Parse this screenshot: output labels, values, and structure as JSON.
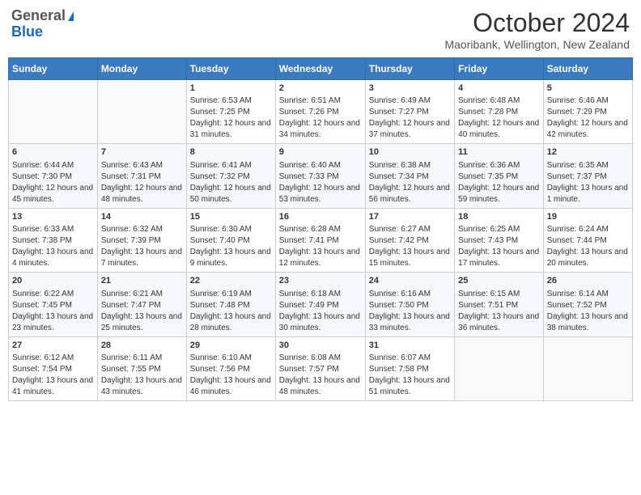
{
  "logo": {
    "general": "General",
    "blue": "Blue"
  },
  "title": "October 2024",
  "subtitle": "Maoribank, Wellington, New Zealand",
  "days_of_week": [
    "Sunday",
    "Monday",
    "Tuesday",
    "Wednesday",
    "Thursday",
    "Friday",
    "Saturday"
  ],
  "weeks": [
    [
      {
        "day": "",
        "sunrise": "",
        "sunset": "",
        "daylight": ""
      },
      {
        "day": "",
        "sunrise": "",
        "sunset": "",
        "daylight": ""
      },
      {
        "day": "1",
        "sunrise": "Sunrise: 6:53 AM",
        "sunset": "Sunset: 7:25 PM",
        "daylight": "Daylight: 12 hours and 31 minutes."
      },
      {
        "day": "2",
        "sunrise": "Sunrise: 6:51 AM",
        "sunset": "Sunset: 7:26 PM",
        "daylight": "Daylight: 12 hours and 34 minutes."
      },
      {
        "day": "3",
        "sunrise": "Sunrise: 6:49 AM",
        "sunset": "Sunset: 7:27 PM",
        "daylight": "Daylight: 12 hours and 37 minutes."
      },
      {
        "day": "4",
        "sunrise": "Sunrise: 6:48 AM",
        "sunset": "Sunset: 7:28 PM",
        "daylight": "Daylight: 12 hours and 40 minutes."
      },
      {
        "day": "5",
        "sunrise": "Sunrise: 6:46 AM",
        "sunset": "Sunset: 7:29 PM",
        "daylight": "Daylight: 12 hours and 42 minutes."
      }
    ],
    [
      {
        "day": "6",
        "sunrise": "Sunrise: 6:44 AM",
        "sunset": "Sunset: 7:30 PM",
        "daylight": "Daylight: 12 hours and 45 minutes."
      },
      {
        "day": "7",
        "sunrise": "Sunrise: 6:43 AM",
        "sunset": "Sunset: 7:31 PM",
        "daylight": "Daylight: 12 hours and 48 minutes."
      },
      {
        "day": "8",
        "sunrise": "Sunrise: 6:41 AM",
        "sunset": "Sunset: 7:32 PM",
        "daylight": "Daylight: 12 hours and 50 minutes."
      },
      {
        "day": "9",
        "sunrise": "Sunrise: 6:40 AM",
        "sunset": "Sunset: 7:33 PM",
        "daylight": "Daylight: 12 hours and 53 minutes."
      },
      {
        "day": "10",
        "sunrise": "Sunrise: 6:38 AM",
        "sunset": "Sunset: 7:34 PM",
        "daylight": "Daylight: 12 hours and 56 minutes."
      },
      {
        "day": "11",
        "sunrise": "Sunrise: 6:36 AM",
        "sunset": "Sunset: 7:35 PM",
        "daylight": "Daylight: 12 hours and 59 minutes."
      },
      {
        "day": "12",
        "sunrise": "Sunrise: 6:35 AM",
        "sunset": "Sunset: 7:37 PM",
        "daylight": "Daylight: 13 hours and 1 minute."
      }
    ],
    [
      {
        "day": "13",
        "sunrise": "Sunrise: 6:33 AM",
        "sunset": "Sunset: 7:38 PM",
        "daylight": "Daylight: 13 hours and 4 minutes."
      },
      {
        "day": "14",
        "sunrise": "Sunrise: 6:32 AM",
        "sunset": "Sunset: 7:39 PM",
        "daylight": "Daylight: 13 hours and 7 minutes."
      },
      {
        "day": "15",
        "sunrise": "Sunrise: 6:30 AM",
        "sunset": "Sunset: 7:40 PM",
        "daylight": "Daylight: 13 hours and 9 minutes."
      },
      {
        "day": "16",
        "sunrise": "Sunrise: 6:28 AM",
        "sunset": "Sunset: 7:41 PM",
        "daylight": "Daylight: 13 hours and 12 minutes."
      },
      {
        "day": "17",
        "sunrise": "Sunrise: 6:27 AM",
        "sunset": "Sunset: 7:42 PM",
        "daylight": "Daylight: 13 hours and 15 minutes."
      },
      {
        "day": "18",
        "sunrise": "Sunrise: 6:25 AM",
        "sunset": "Sunset: 7:43 PM",
        "daylight": "Daylight: 13 hours and 17 minutes."
      },
      {
        "day": "19",
        "sunrise": "Sunrise: 6:24 AM",
        "sunset": "Sunset: 7:44 PM",
        "daylight": "Daylight: 13 hours and 20 minutes."
      }
    ],
    [
      {
        "day": "20",
        "sunrise": "Sunrise: 6:22 AM",
        "sunset": "Sunset: 7:45 PM",
        "daylight": "Daylight: 13 hours and 23 minutes."
      },
      {
        "day": "21",
        "sunrise": "Sunrise: 6:21 AM",
        "sunset": "Sunset: 7:47 PM",
        "daylight": "Daylight: 13 hours and 25 minutes."
      },
      {
        "day": "22",
        "sunrise": "Sunrise: 6:19 AM",
        "sunset": "Sunset: 7:48 PM",
        "daylight": "Daylight: 13 hours and 28 minutes."
      },
      {
        "day": "23",
        "sunrise": "Sunrise: 6:18 AM",
        "sunset": "Sunset: 7:49 PM",
        "daylight": "Daylight: 13 hours and 30 minutes."
      },
      {
        "day": "24",
        "sunrise": "Sunrise: 6:16 AM",
        "sunset": "Sunset: 7:50 PM",
        "daylight": "Daylight: 13 hours and 33 minutes."
      },
      {
        "day": "25",
        "sunrise": "Sunrise: 6:15 AM",
        "sunset": "Sunset: 7:51 PM",
        "daylight": "Daylight: 13 hours and 36 minutes."
      },
      {
        "day": "26",
        "sunrise": "Sunrise: 6:14 AM",
        "sunset": "Sunset: 7:52 PM",
        "daylight": "Daylight: 13 hours and 38 minutes."
      }
    ],
    [
      {
        "day": "27",
        "sunrise": "Sunrise: 6:12 AM",
        "sunset": "Sunset: 7:54 PM",
        "daylight": "Daylight: 13 hours and 41 minutes."
      },
      {
        "day": "28",
        "sunrise": "Sunrise: 6:11 AM",
        "sunset": "Sunset: 7:55 PM",
        "daylight": "Daylight: 13 hours and 43 minutes."
      },
      {
        "day": "29",
        "sunrise": "Sunrise: 6:10 AM",
        "sunset": "Sunset: 7:56 PM",
        "daylight": "Daylight: 13 hours and 46 minutes."
      },
      {
        "day": "30",
        "sunrise": "Sunrise: 6:08 AM",
        "sunset": "Sunset: 7:57 PM",
        "daylight": "Daylight: 13 hours and 48 minutes."
      },
      {
        "day": "31",
        "sunrise": "Sunrise: 6:07 AM",
        "sunset": "Sunset: 7:58 PM",
        "daylight": "Daylight: 13 hours and 51 minutes."
      },
      {
        "day": "",
        "sunrise": "",
        "sunset": "",
        "daylight": ""
      },
      {
        "day": "",
        "sunrise": "",
        "sunset": "",
        "daylight": ""
      }
    ]
  ]
}
